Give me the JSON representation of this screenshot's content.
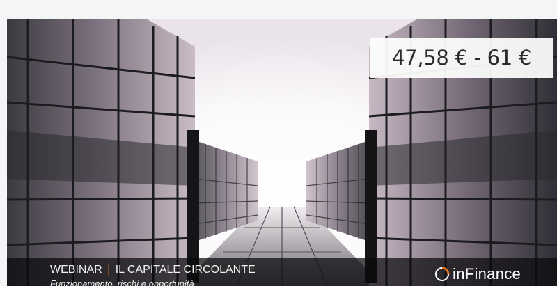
{
  "product_card": {
    "image_alt": "Webinar Il capitale circolante - inFinance",
    "price_range": "47,58 € - 61 €",
    "banner": {
      "prefix": "WEBINAR",
      "separator": "|",
      "title": "IL CAPITALE CIRCOLANTE",
      "subtitle": "Funzionamento, rischi e opportunità"
    },
    "brand": {
      "name": "inFinance",
      "logo_icon": "infinance-logo-icon",
      "accent_color": "#e2701c"
    }
  }
}
